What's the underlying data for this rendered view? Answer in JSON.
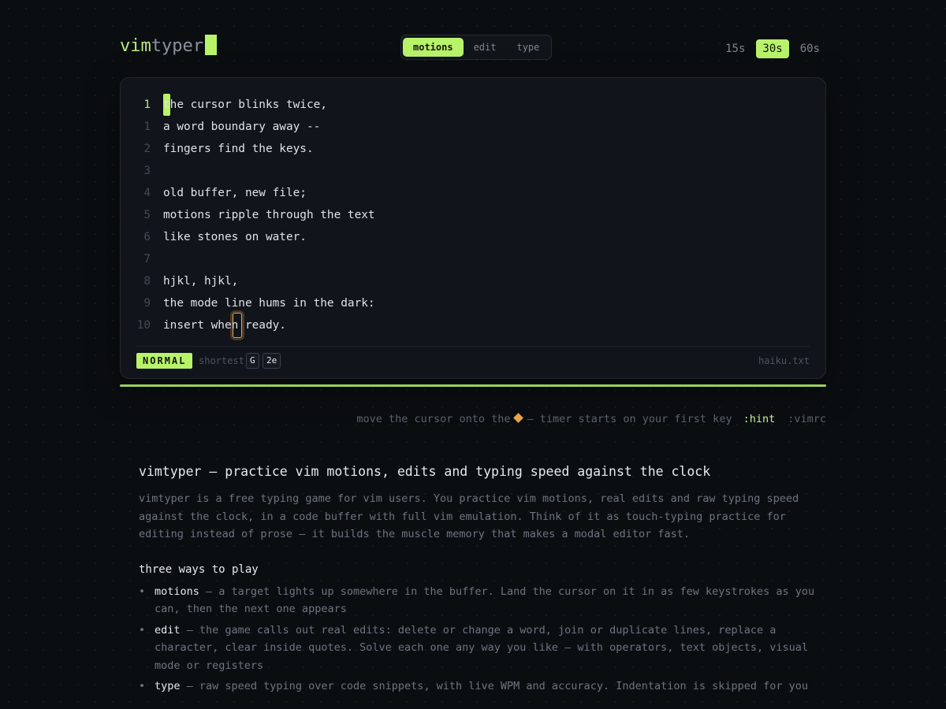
{
  "logo": {
    "part1": "vim",
    "part2": "typer"
  },
  "modes": [
    {
      "label": "motions",
      "active": true
    },
    {
      "label": "edit",
      "active": false
    },
    {
      "label": "type",
      "active": false
    }
  ],
  "times": [
    {
      "label": "15s",
      "active": false
    },
    {
      "label": "30s",
      "active": true
    },
    {
      "label": "60s",
      "active": false
    }
  ],
  "editor": {
    "lines": [
      {
        "num": "1",
        "text": "the cursor blinks twice,"
      },
      {
        "num": "1",
        "text": "a word boundary away --"
      },
      {
        "num": "2",
        "text": "fingers find the keys."
      },
      {
        "num": "3",
        "text": ""
      },
      {
        "num": "4",
        "text": "old buffer, new file;"
      },
      {
        "num": "5",
        "text": "motions ripple through the text"
      },
      {
        "num": "6",
        "text": "like stones on water."
      },
      {
        "num": "7",
        "text": ""
      },
      {
        "num": "8",
        "text": "hjkl, hjkl,"
      },
      {
        "num": "9",
        "text": "the mode line hums in the dark:"
      },
      {
        "num": "10",
        "text": "insert when ready."
      }
    ]
  },
  "status": {
    "mode": "NORMAL",
    "shortest_label": "shortest",
    "keys": [
      "G",
      "2e"
    ],
    "filename": "haiku.txt"
  },
  "hint": {
    "before": "move the cursor onto the",
    "after": "— timer starts on your first key",
    "hint_cmd": ":hint",
    "vimrc_cmd": ":vimrc"
  },
  "content": {
    "title": "vimtyper — practice vim motions, edits and typing speed against the clock",
    "intro": "vimtyper is a free typing game for vim users. You practice vim motions, real edits and raw typing speed against the clock, in a code buffer with full vim emulation. Think of it as touch-typing practice for editing instead of prose — it builds the muscle memory that makes a modal editor fast.",
    "subheading": "three ways to play",
    "items": [
      {
        "term": "motions",
        "desc": " — a target lights up somewhere in the buffer. Land the cursor on it in as few keystrokes as you can, then the next one appears"
      },
      {
        "term": "edit",
        "desc": " — the game calls out real edits: delete or change a word, join or duplicate lines, replace a character, clear inside quotes. Solve each one any way you like — with operators, text objects, visual mode or registers"
      },
      {
        "term": "type",
        "desc": " — raw speed typing over code snippets, with live WPM and accuracy. Indentation is skipped for you"
      }
    ]
  },
  "colors": {
    "accent": "#b8f36a",
    "target": "#e8a446",
    "background": "#0b0e11",
    "panel": "#11141a"
  }
}
